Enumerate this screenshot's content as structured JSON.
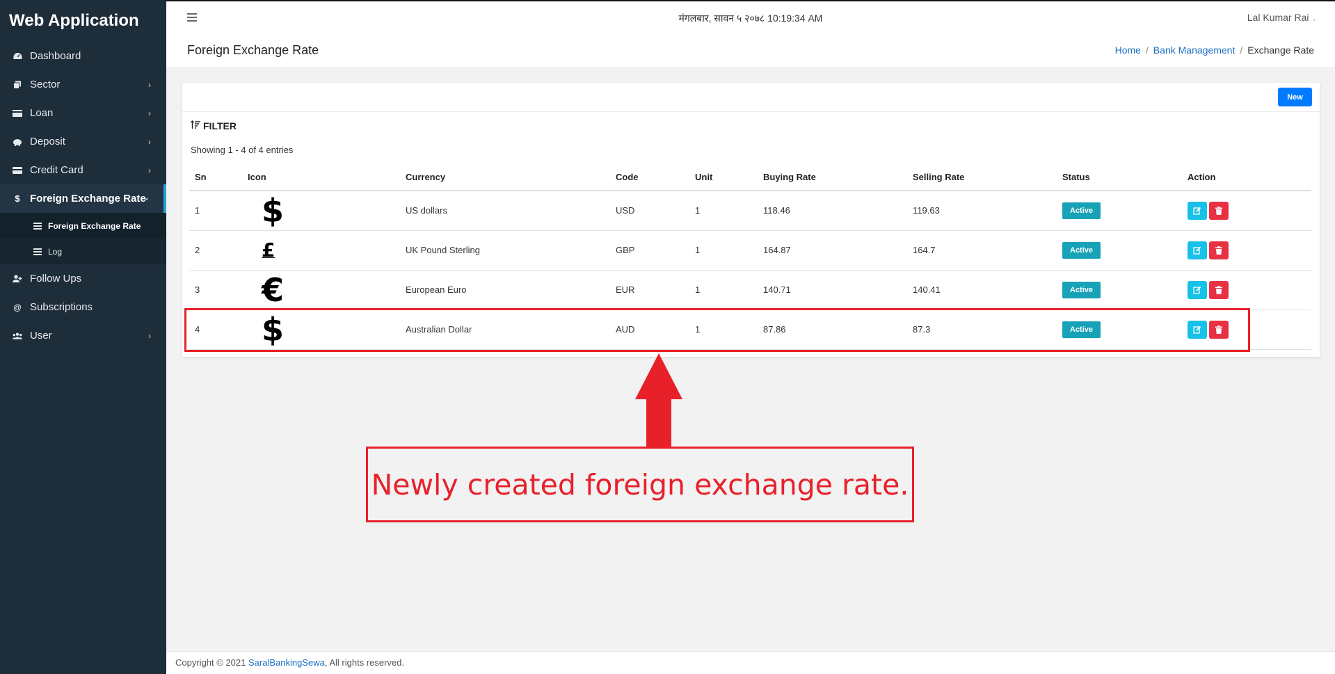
{
  "app": {
    "title": "Web Application"
  },
  "sidebar": {
    "items": [
      {
        "label": "Dashboard",
        "icon": "dashboard-icon",
        "chevron": false
      },
      {
        "label": "Sector",
        "icon": "copy-icon",
        "chevron": true
      },
      {
        "label": "Loan",
        "icon": "money-icon",
        "chevron": true
      },
      {
        "label": "Deposit",
        "icon": "piggy-bank-icon",
        "chevron": true
      },
      {
        "label": "Credit Card",
        "icon": "credit-card-icon",
        "chevron": true
      },
      {
        "label": "Foreign Exchange Rate",
        "icon": "dollar-icon",
        "chevron": true,
        "active": true
      },
      {
        "label": "Follow Ups",
        "icon": "user-plus-icon",
        "chevron": false
      },
      {
        "label": "Subscriptions",
        "icon": "at-icon",
        "chevron": false
      },
      {
        "label": "User",
        "icon": "users-icon",
        "chevron": true
      }
    ],
    "subitems": [
      {
        "label": "Foreign Exchange Rate",
        "current": true
      },
      {
        "label": "Log",
        "current": false
      }
    ]
  },
  "topbar": {
    "datetime": "मंगलबार, सावन ५ २०७८ 10:19:34 AM",
    "user": "Lal Kumar Rai"
  },
  "page": {
    "title": "Foreign Exchange Rate",
    "breadcrumb": [
      "Home",
      "Bank Management",
      "Exchange Rate"
    ]
  },
  "card": {
    "new_button": "New",
    "filter_label": "FILTER",
    "showing": "Showing 1 - 4 of 4 entries"
  },
  "table": {
    "columns": [
      "Sn",
      "Icon",
      "Currency",
      "Code",
      "Unit",
      "Buying Rate",
      "Selling Rate",
      "Status",
      "Action"
    ],
    "rows": [
      {
        "sn": "1",
        "icon": "$",
        "currency": "US dollars",
        "code": "USD",
        "unit": "1",
        "buying": "118.46",
        "selling": "119.63",
        "status": "Active"
      },
      {
        "sn": "2",
        "icon": "£",
        "currency": "UK Pound Sterling",
        "code": "GBP",
        "unit": "1",
        "buying": "164.87",
        "selling": "164.7",
        "status": "Active"
      },
      {
        "sn": "3",
        "icon": "€",
        "currency": "European Euro",
        "code": "EUR",
        "unit": "1",
        "buying": "140.71",
        "selling": "140.41",
        "status": "Active"
      },
      {
        "sn": "4",
        "icon": "$",
        "currency": "Australian Dollar",
        "code": "AUD",
        "unit": "1",
        "buying": "87.86",
        "selling": "87.3",
        "status": "Active"
      }
    ]
  },
  "annotation": {
    "text": "Newly created foreign exchange rate."
  },
  "footer": {
    "prefix": "Copyright © 2021",
    "link": "SaralBankingSewa",
    "suffix": ", All rights reserved."
  },
  "colors": {
    "sidebar_bg": "#1e2d3a",
    "primary": "#007bff",
    "badge": "#17a2b8",
    "edit": "#17c1e8",
    "delete": "#e83143",
    "annotation": "#e8202a"
  }
}
